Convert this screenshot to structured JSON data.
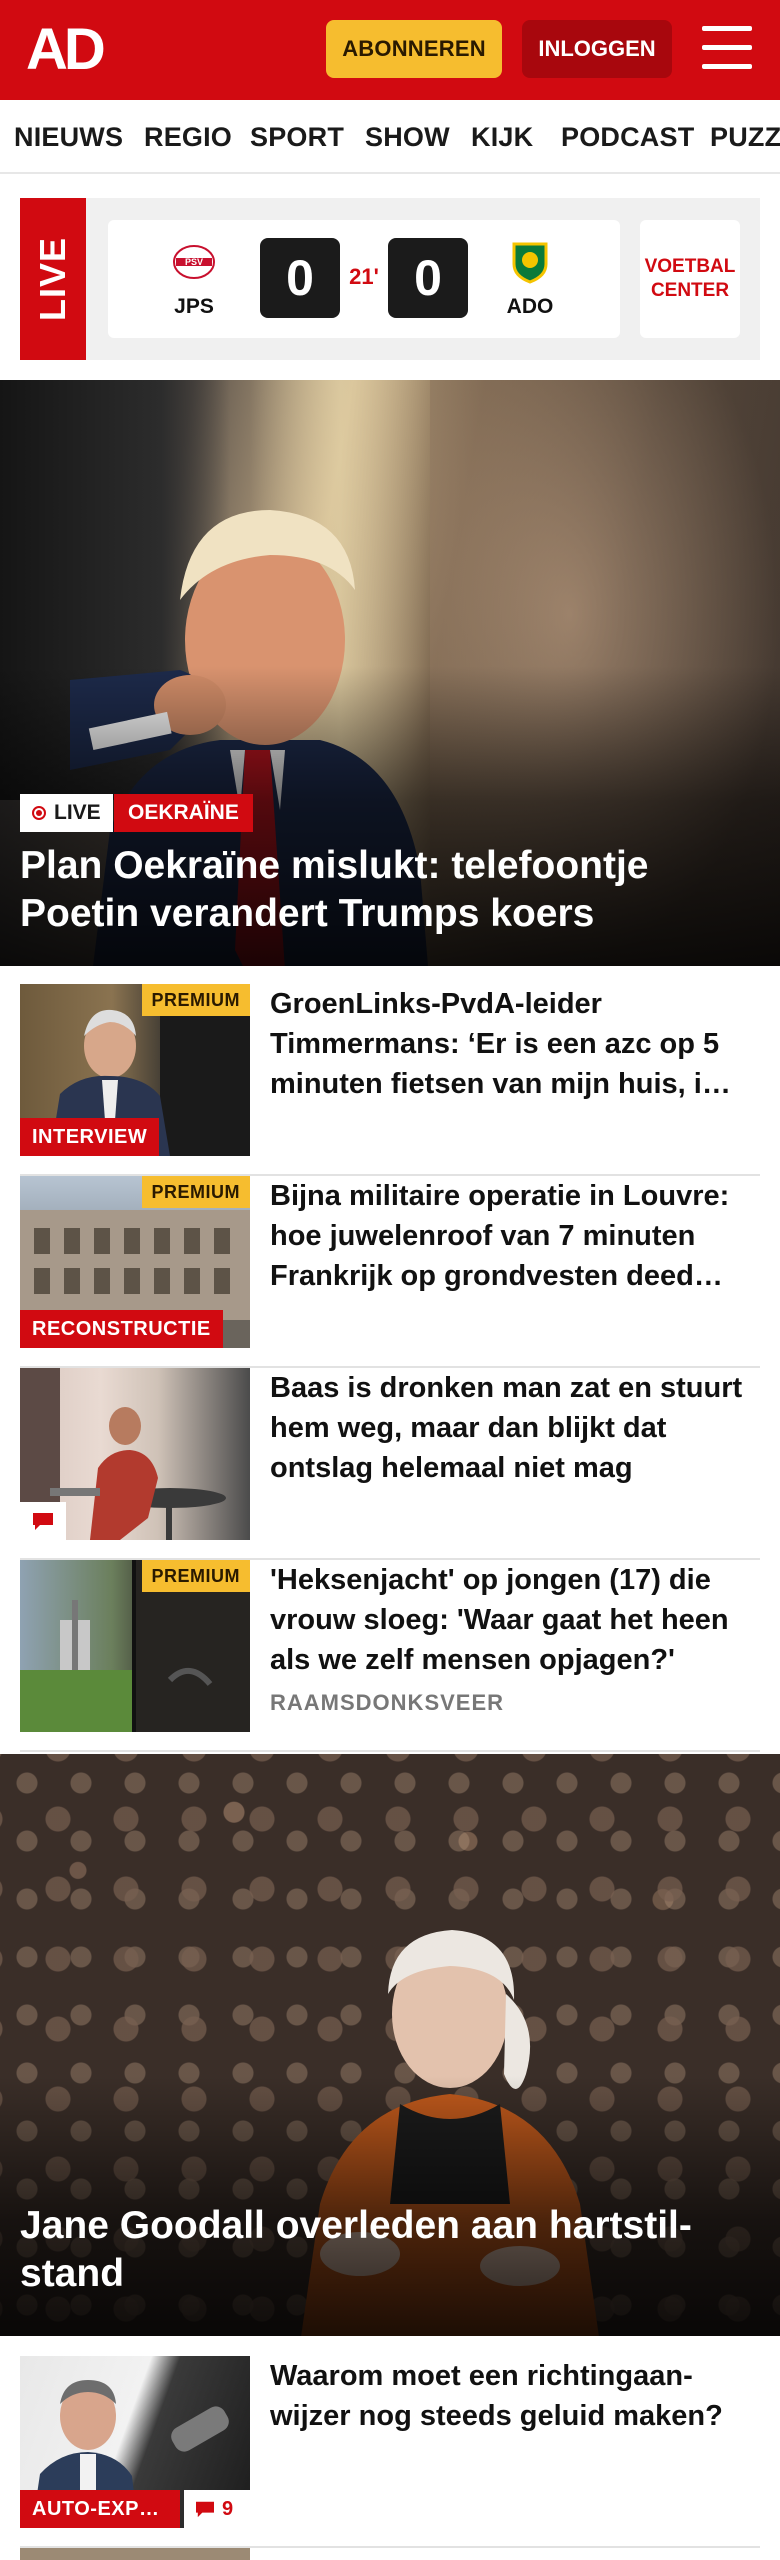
{
  "header": {
    "logo": "AD",
    "subscribe_label": "ABONNEREN",
    "login_label": "INLOGGEN",
    "brand_color": "#d10a11"
  },
  "nav": {
    "items": [
      "NIEUWS",
      "REGIO",
      "SPORT",
      "SHOW",
      "KIJK",
      "PODCAST",
      "PUZZ"
    ]
  },
  "live_score": {
    "tag": "LIVE",
    "home_team": "JPS",
    "home_score": "0",
    "minute": "21'",
    "away_score": "0",
    "away_team": "ADO",
    "voetbal_center_line1": "VOETBAL",
    "voetbal_center_line2": "CENTER"
  },
  "hero": {
    "live_label": "LIVE",
    "category": "OEKRAÏNE",
    "title": "Plan Oekraïne mislukt: telefoontje Poetin verandert Trumps koers"
  },
  "articles": [
    {
      "premium": "PREMIUM",
      "label": "INTERVIEW",
      "title": "GroenLinks-PvdA-leider Timmermans: ‘Er is een azc op 5 minuten fietsen van mijn huis, i…"
    },
    {
      "premium": "PREMIUM",
      "label": "RECONSTRUCTIE",
      "title": "Bijna militaire operatie in Louvre: hoe juwelenroof van 7 minuten Frankrijk op grondvesten deed…"
    },
    {
      "title": "Baas is dronken man zat en stuurt hem weg, maar dan blijkt dat ontslag helemaal niet mag"
    },
    {
      "premium": "PREMIUM",
      "title": "'Heksenjacht' op jongen (17) die vrouw sloeg: 'Waar gaat het heen als we zelf mensen opjagen?'",
      "kicker": "RAAMSDONKSVEER"
    }
  ],
  "hero2": {
    "title": "Jane Goodall overleden aan hartstil­stand"
  },
  "article_auto": {
    "label": "AUTO-EXP…",
    "comments": "9",
    "title": "Waarom moet een richtingaan­wijzer nog steeds geluid maken?"
  }
}
